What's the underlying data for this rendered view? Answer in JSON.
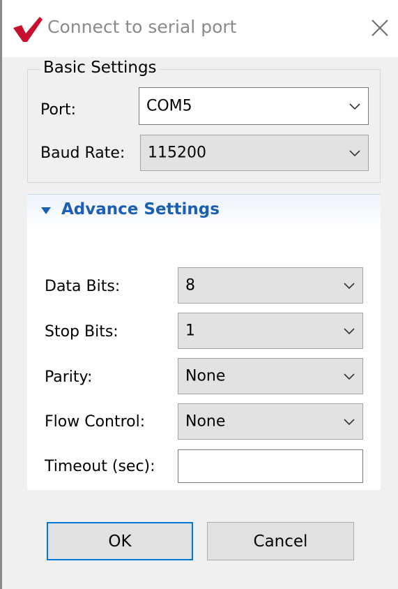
{
  "window": {
    "title": "Connect to serial port",
    "close_glyph": "✕"
  },
  "basic": {
    "legend": "Basic Settings",
    "port_label": "Port:",
    "port_value": "COM5",
    "baud_label": "Baud Rate:",
    "baud_value": "115200"
  },
  "advance": {
    "title": "Advance Settings",
    "data_bits_label": "Data Bits:",
    "data_bits_value": "8",
    "stop_bits_label": "Stop Bits:",
    "stop_bits_value": "1",
    "parity_label": "Parity:",
    "parity_value": "None",
    "flow_label": "Flow Control:",
    "flow_value": "None",
    "timeout_label": "Timeout (sec):",
    "timeout_value": ""
  },
  "buttons": {
    "ok": "OK",
    "cancel": "Cancel"
  },
  "colors": {
    "accent": "#0078d7",
    "section_title": "#1a5fb4",
    "app_icon": "#c8102e"
  },
  "icons": {
    "app": "checkmark-logo-icon",
    "close": "close-icon",
    "dropdown": "chevron-down-icon",
    "expander": "triangle-down-icon"
  }
}
